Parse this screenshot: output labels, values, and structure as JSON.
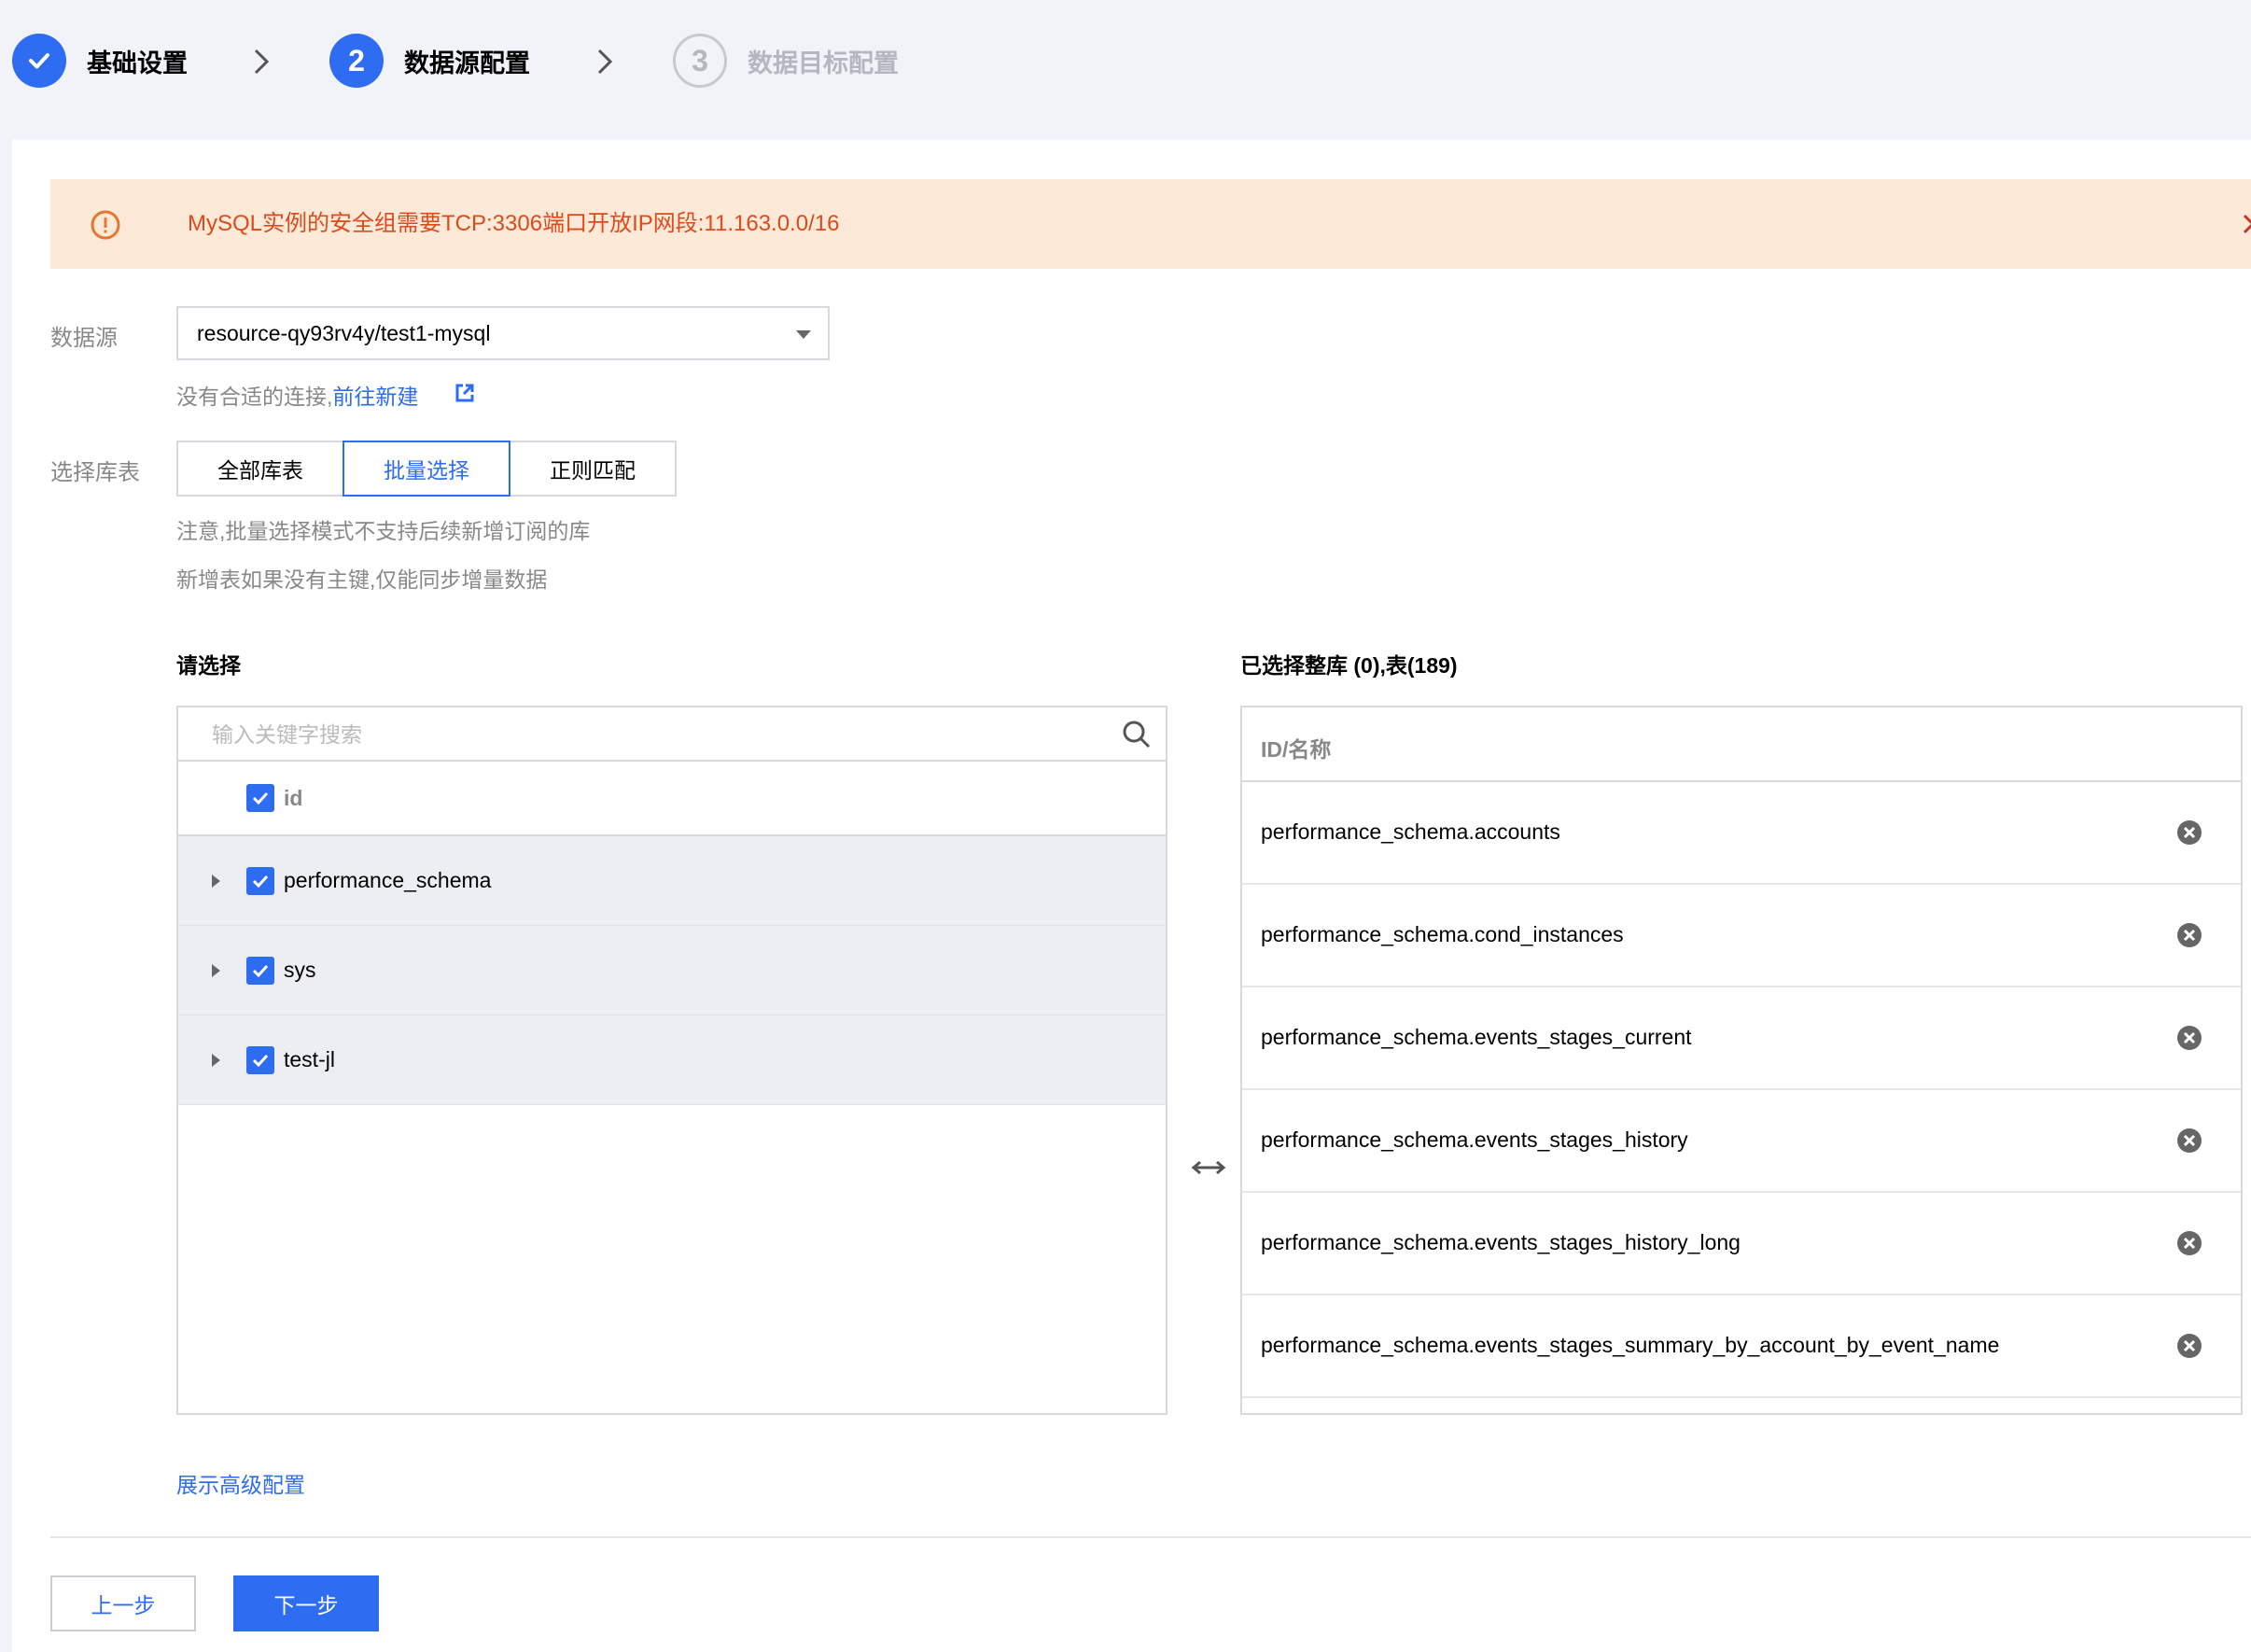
{
  "steps": [
    {
      "label": "基础设置",
      "state": "done",
      "number": ""
    },
    {
      "label": "数据源配置",
      "state": "active",
      "number": "2"
    },
    {
      "label": "数据目标配置",
      "state": "pending",
      "number": "3"
    }
  ],
  "alert": {
    "text": "MySQL实例的安全组需要TCP:3306端口开放IP网段:11.163.0.0/16",
    "color": "#de4a1a",
    "background": "#fde9d8"
  },
  "form": {
    "datasource_label": "数据源",
    "datasource_value": "resource-qy93rv4y/test1-mysql",
    "no_conn_hint": "没有合适的连接,",
    "create_link": "前往新建",
    "select_tables_label": "选择库表",
    "modes": [
      "全部库表",
      "批量选择",
      "正则匹配"
    ],
    "active_mode": "批量选择",
    "note1": "注意,批量选择模式不支持后续新增订阅的库",
    "note2": "新增表如果没有主键,仅能同步增量数据"
  },
  "left_panel": {
    "title": "请选择",
    "search_placeholder": "输入关键字搜索",
    "header_label": "id",
    "items": [
      "performance_schema",
      "sys",
      "test-jl"
    ]
  },
  "right_panel": {
    "title": "已选择整库 (0),表(189)",
    "header": "ID/名称",
    "items": [
      "performance_schema.accounts",
      "performance_schema.cond_instances",
      "performance_schema.events_stages_current",
      "performance_schema.events_stages_history",
      "performance_schema.events_stages_history_long",
      "performance_schema.events_stages_summary_by_account_by_event_name"
    ]
  },
  "footer": {
    "advanced_link": "展示高级配置",
    "prev_label": "上一步",
    "next_label": "下一步"
  },
  "colors": {
    "primary": "#2e6cf1",
    "border": "#d7d9de",
    "muted": "#888888"
  },
  "icons": {
    "done": "check-icon",
    "step_sep": "chevron-right-icon",
    "alert": "warning-circle-icon",
    "close": "close-icon",
    "external": "external-link-icon",
    "search": "search-icon",
    "transfer": "transfer-arrows-icon",
    "remove": "remove-circle-icon"
  }
}
